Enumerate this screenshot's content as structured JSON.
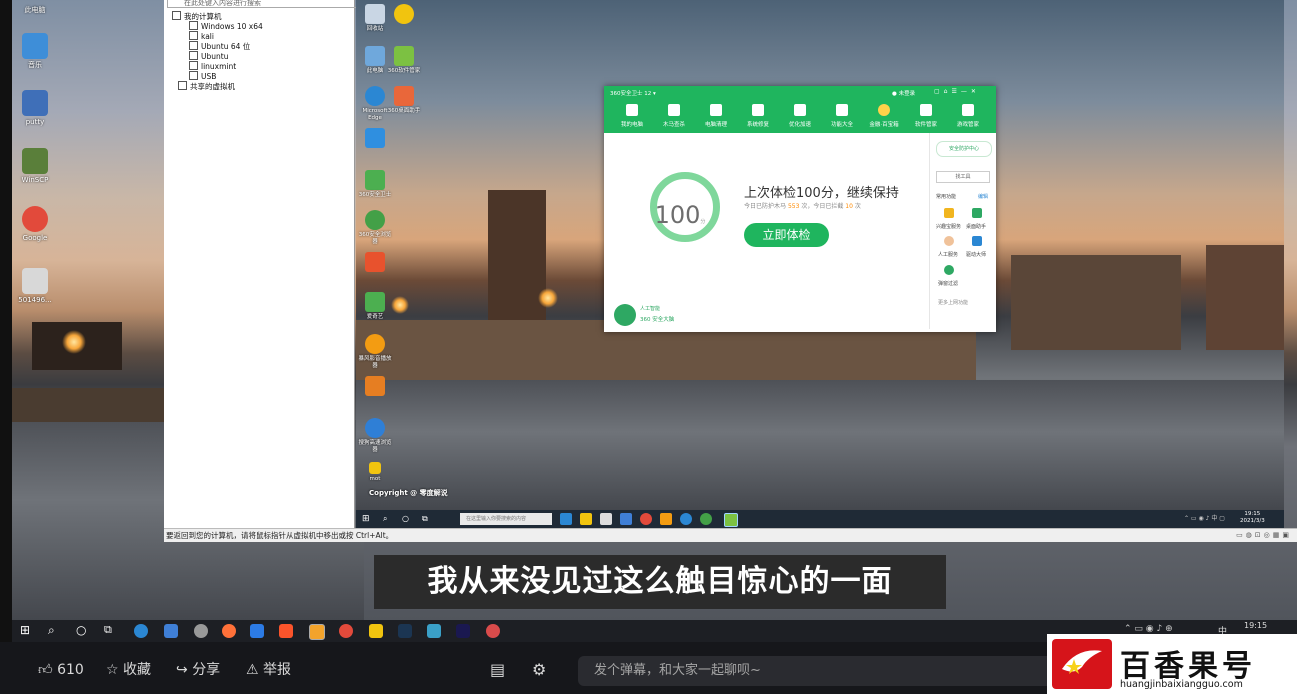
{
  "host_desktop": {
    "icons": [
      {
        "label": "此电脑",
        "color": "#8aa0b5"
      },
      {
        "label": "音乐",
        "color": "#3e8ed8"
      },
      {
        "label": "putty",
        "color": "#3f6fb8"
      },
      {
        "label": "WinSCP",
        "color": "#5a7f3a"
      },
      {
        "label": "Google",
        "color": "#e24a3b"
      },
      {
        "label": "501496...",
        "color": "#d8d8d8"
      }
    ]
  },
  "vm_panel": {
    "search_placeholder": "在此处键入内容进行搜索",
    "tree": {
      "root": "我的计算机",
      "items": [
        "Windows 10 x64",
        "kali",
        "Ubuntu 64 位",
        "Ubuntu",
        "linuxmint",
        "USB"
      ],
      "shared": "共享的虚拟机"
    },
    "status_text": "要返回到您的计算机，请将鼠标指针从虚拟机中移出或按 Ctrl+Alt。"
  },
  "guest_desktop": {
    "icons": [
      {
        "label": "回收站",
        "color": "#c9d6e4"
      },
      {
        "label": "",
        "color": "#f1c40f"
      },
      {
        "label": "此电脑",
        "color": "#6fa8dc"
      },
      {
        "label": "360软件管家",
        "color": "#7cc142"
      },
      {
        "label": "Microsoft Edge",
        "color": "#2b87d3"
      },
      {
        "label": "360桌面助手",
        "color": "#e9673a"
      },
      {
        "label": "",
        "color": "#2f8fe0"
      },
      {
        "label": "360安全卫士",
        "color": "#4caf50"
      },
      {
        "label": "360安全浏览器",
        "color": "#43a047"
      },
      {
        "label": "",
        "color": "#e8522d"
      },
      {
        "label": "爱奇艺",
        "color": "#4caf50"
      },
      {
        "label": "暴风影音播放器",
        "color": "#f39c12"
      },
      {
        "label": "",
        "color": "#e67e22"
      },
      {
        "label": "搜狗高速浏览器",
        "color": "#2f7fd6"
      },
      {
        "label": "mot",
        "color": "#f1c40f"
      }
    ],
    "copyright": "Copyright @ 零度解说"
  },
  "guest_taskbar": {
    "search_placeholder": "在这里输入你要搜索的内容",
    "time": "19:15",
    "date": "2021/3/3"
  },
  "window_360": {
    "title": "360安全卫士 12 ▾",
    "login": "未登录",
    "nav": [
      "我的电脑",
      "木马查杀",
      "电脑清理",
      "系统修复",
      "优化加速",
      "功能大全",
      "金融·百宝箱",
      "软件管家",
      "游戏管家"
    ],
    "score": "100",
    "score_unit": "分",
    "headline": "上次体检100分，继续保持",
    "subline_1": "今日已防护木马",
    "subline_num1": "553",
    "subline_2": "次，今日已拦截",
    "subline_num2": "10",
    "subline_3": "次",
    "check_button": "立即体检",
    "protect_center": "安全防护中心",
    "side_search": "找工具",
    "side_header": "常用功能",
    "side_edit": "编辑",
    "side_tools": [
      "兴趣宝服务",
      "桌面助手",
      "人工服务",
      "驱动大师",
      "弹窗过滤"
    ],
    "side_more": "更多上网功能",
    "brand": "360 安全大脑",
    "brand_badge": "人工智能"
  },
  "subtitle": "我从来没见过这么触目惊心的一面",
  "host_taskbar": {
    "time": "19:15",
    "ime": "中",
    "apps": [
      {
        "name": "edge",
        "color": "#2b87d3"
      },
      {
        "name": "mail",
        "color": "#3f7fd6"
      },
      {
        "name": "clock",
        "color": "#999999"
      },
      {
        "name": "firefox",
        "color": "#ff7139"
      },
      {
        "name": "todo",
        "color": "#2c7be5"
      },
      {
        "name": "brave",
        "color": "#fb542b"
      },
      {
        "name": "vmware",
        "color": "#f2a32b"
      },
      {
        "name": "chrome",
        "color": "#e24a3b"
      },
      {
        "name": "explorer",
        "color": "#f1c40f"
      },
      {
        "name": "photoshop",
        "color": "#1b3552"
      },
      {
        "name": "photos",
        "color": "#3aa0c8"
      },
      {
        "name": "premiere",
        "color": "#1a1850"
      },
      {
        "name": "app",
        "color": "#d94b4b"
      }
    ]
  },
  "bottom_bar": {
    "likes": "610",
    "favorite": "收藏",
    "share": "分享",
    "report": "举报",
    "danmaku_placeholder": "发个弹幕，和大家一起聊呗~"
  },
  "watermark": {
    "title": "百香果号",
    "url": "huangjinbaixiangguo.com"
  }
}
